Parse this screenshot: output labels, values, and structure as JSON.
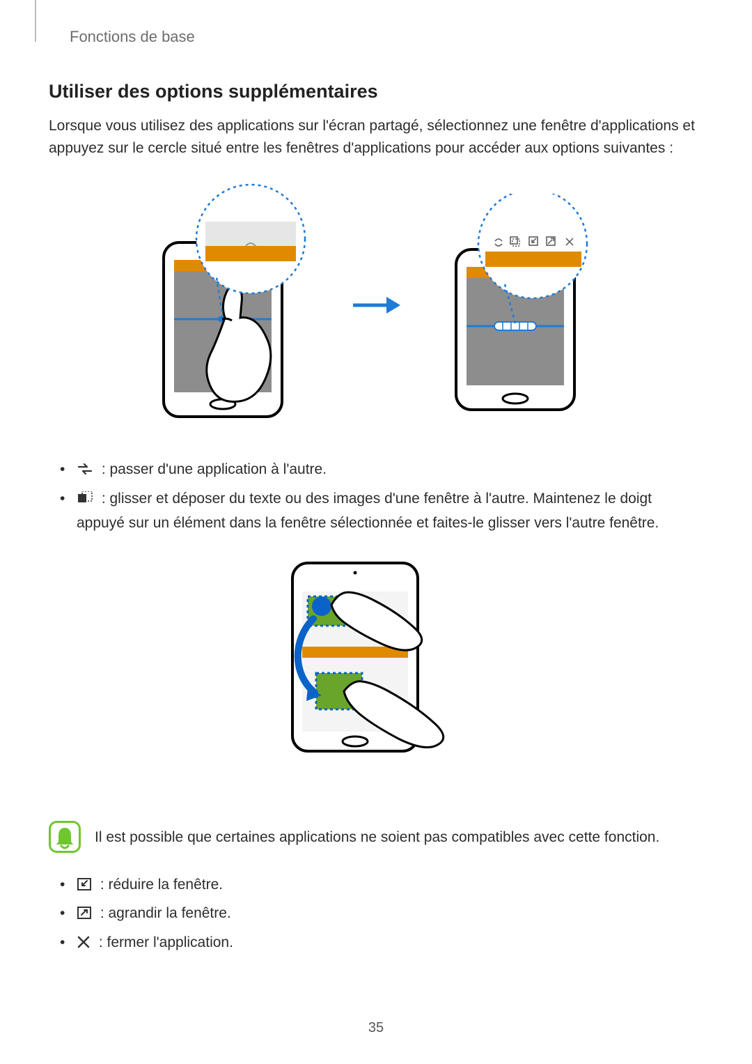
{
  "chapter": "Fonctions de base",
  "heading": "Utiliser des options supplémentaires",
  "intro": "Lorsque vous utilisez des applications sur l'écran partagé, sélectionnez une fenêtre d'applications et appuyez sur le cercle situé entre les fenêtres d'applications pour accéder aux options suivantes :",
  "list1": {
    "item1_text": " : passer d'une application à l'autre.",
    "item2_text": " : glisser et déposer du texte ou des images d'une fenêtre à l'autre. Maintenez le doigt appuyé sur un élément dans la fenêtre sélectionnée et faites-le glisser vers l'autre fenêtre."
  },
  "note": "Il est possible que certaines applications ne soient pas compatibles avec cette fonction.",
  "list2": {
    "item1_text": " : réduire la fenêtre.",
    "item2_text": " : agrandir la fenêtre.",
    "item3_text": " : fermer l'application."
  },
  "page_number": "35"
}
